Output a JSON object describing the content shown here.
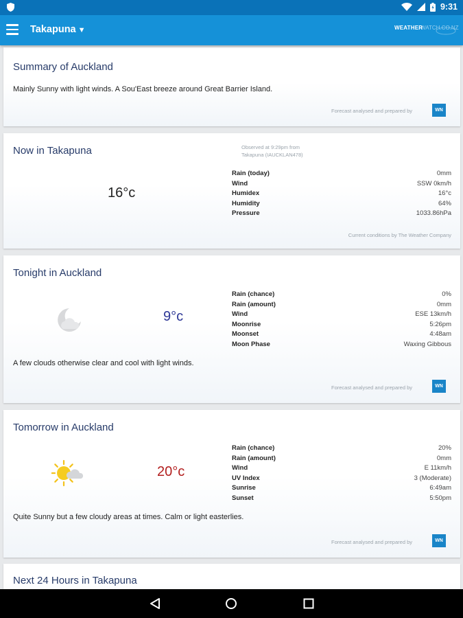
{
  "status_bar": {
    "time": "9:31",
    "icons": [
      "shield-icon",
      "wifi-icon",
      "cell-signal-icon",
      "battery-icon"
    ]
  },
  "app_bar": {
    "location": "Takapuna",
    "brand_text_1": "WEATHER",
    "brand_text_2": "WATCH.CO.NZ",
    "icons": [
      "menu-icon",
      "caret-down-icon"
    ]
  },
  "colors": {
    "app_bar": "#1591d8",
    "status_bar": "#0a72b8",
    "title": "#273b69",
    "cold_temp": "#2c3696",
    "warm_temp": "#b21e1e"
  },
  "summary": {
    "title": "Summary of Auckland",
    "text": "Mainly Sunny with light winds. A Sou'East breeze around Great Barrier Island.",
    "credit": "Forecast analysed and prepared by",
    "logo": "WN"
  },
  "now": {
    "title": "Now in Takapuna",
    "observed_line1": "Observed at 9:29pm from",
    "observed_line2": "Takapuna (IAUCKLAN478)",
    "temp": "16°c",
    "rows": [
      {
        "label": "Rain (today)",
        "value": "0mm"
      },
      {
        "label": "Wind",
        "value": "SSW 0km/h"
      },
      {
        "label": "Humidex",
        "value": "16°c"
      },
      {
        "label": "Humidity",
        "value": "64%"
      },
      {
        "label": "Pressure",
        "value": "1033.86hPa"
      }
    ],
    "credit": "Current conditions by The Weather Company"
  },
  "tonight": {
    "title": "Tonight in Auckland",
    "icon": "moon-cloud-icon",
    "temp": "9°c",
    "rows": [
      {
        "label": "Rain (chance)",
        "value": "0%"
      },
      {
        "label": "Rain (amount)",
        "value": "0mm"
      },
      {
        "label": "Wind",
        "value": "ESE 13km/h"
      },
      {
        "label": "Moonrise",
        "value": "5:26pm"
      },
      {
        "label": "Moonset",
        "value": "4:48am"
      },
      {
        "label": "Moon Phase",
        "value": "Waxing Gibbous"
      }
    ],
    "text": "A few clouds otherwise clear and cool with light winds.",
    "credit": "Forecast analysed and prepared by",
    "logo": "WN"
  },
  "tomorrow": {
    "title": "Tomorrow in Auckland",
    "icon": "sun-cloud-icon",
    "temp": "20°c",
    "rows": [
      {
        "label": "Rain (chance)",
        "value": "20%"
      },
      {
        "label": "Rain (amount)",
        "value": "0mm"
      },
      {
        "label": "Wind",
        "value": "E 11km/h"
      },
      {
        "label": "UV Index",
        "value": "3 (Moderate)"
      },
      {
        "label": "Sunrise",
        "value": "6:49am"
      },
      {
        "label": "Sunset",
        "value": "5:50pm"
      }
    ],
    "text": "Quite Sunny but a few cloudy areas at times. Calm or light easterlies.",
    "credit": "Forecast analysed and prepared by",
    "logo": "WN"
  },
  "next24": {
    "title": "Next 24 Hours in Takapuna"
  },
  "nav_bar": {
    "icons": [
      "back-icon",
      "home-icon",
      "recents-icon"
    ]
  }
}
